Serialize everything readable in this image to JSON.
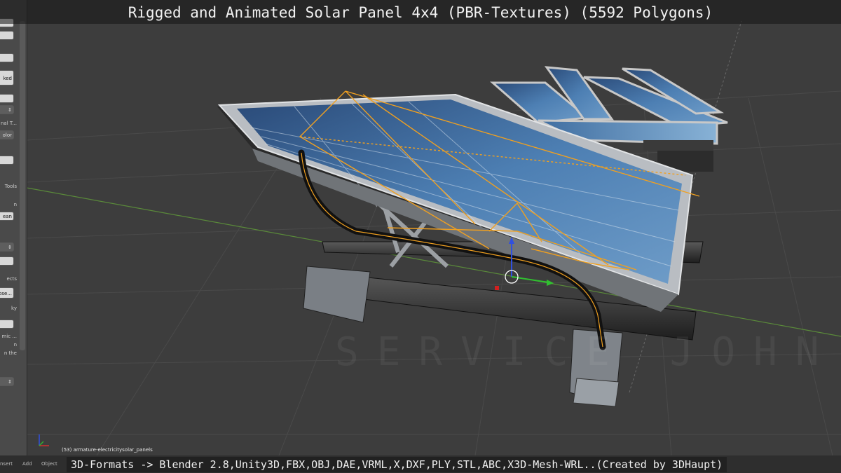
{
  "title": "Rigged and Animated Solar Panel 4x4 (PBR-Textures) (5592 Polygons)",
  "footer": "3D-Formats -> Blender 2.8,Unity3D,FBX,OBJ,DAE,VRML,X,DXF,PLY,STL,ABC,X3D-Mesh-WRL..(Created by 3DHaupt)",
  "object_info": "(53) armature-electricitysolar_panels",
  "footer_menu": {
    "insert": "nsert",
    "add": "Add",
    "object": "Object"
  },
  "tool_panel": {
    "masked_label": "ked",
    "normal_label": "nal T...",
    "color_label": "olor",
    "tools_label": "Tools",
    "n_label": "n",
    "mean_label": "ean",
    "ects_label": "ects",
    "lose_label": "ose...",
    "sky_label": "ky",
    "mic_label": "mic ...",
    "n2_label": "n",
    "nthe_label": "n the"
  },
  "watermark": "SERVICE JOHN",
  "colors": {
    "viewport": "#3d3d3d",
    "rig_orange": "#f0a020",
    "grid_green": "#4a8a2a",
    "grid_red": "#8a3a3a",
    "panel_frame": "#c0c4c8"
  }
}
